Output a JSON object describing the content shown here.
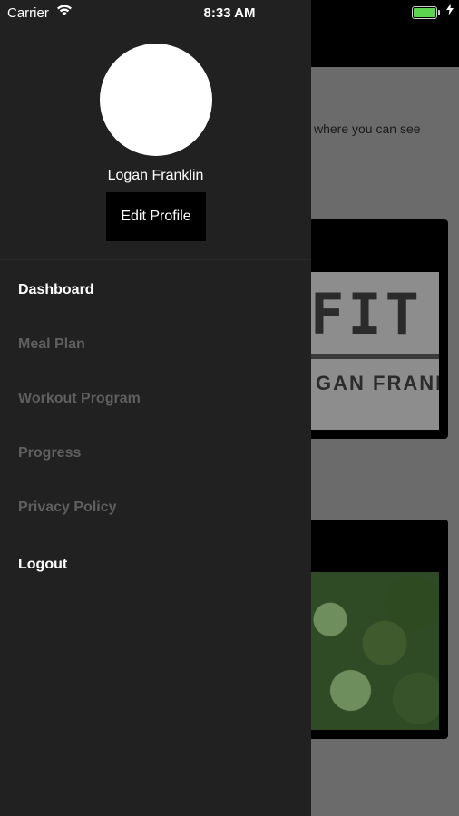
{
  "status_bar": {
    "carrier": "Carrier",
    "time": "8:33 AM",
    "battery_level": 0.92
  },
  "background": {
    "partial_text": "where you can see",
    "card1_logo": {
      "line1": "FIT",
      "line2": "GAN FRANK"
    }
  },
  "drawer": {
    "profile": {
      "name": "Logan Franklin",
      "edit_label": "Edit Profile"
    },
    "menu": [
      {
        "label": "Dashboard",
        "active": true
      },
      {
        "label": "Meal Plan",
        "active": false
      },
      {
        "label": "Workout Program",
        "active": false
      },
      {
        "label": "Progress",
        "active": false
      },
      {
        "label": "Privacy Policy",
        "active": false
      },
      {
        "label": "Logout",
        "active": true
      }
    ]
  },
  "colors": {
    "drawer_bg": "#212121",
    "active_text": "#ffffff",
    "inactive_text": "#5f5f5f",
    "battery": "#5dd44f"
  }
}
